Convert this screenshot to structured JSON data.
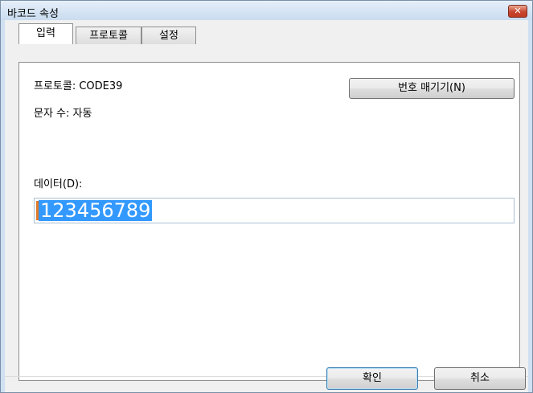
{
  "window": {
    "title": "바코드 속성",
    "close_symbol": "✕"
  },
  "tabs": [
    {
      "label": "입력",
      "active": true
    },
    {
      "label": "프로토콜",
      "active": false
    },
    {
      "label": "설정",
      "active": false
    }
  ],
  "input_tab": {
    "protocol_text": "프로토콜: CODE39",
    "char_count_text": "문자 수: 자동",
    "numbering_button": "번호 매기기(N)",
    "data_label": "데이터(D):",
    "data_value": "123456789"
  },
  "dialog_buttons": {
    "ok": "확인",
    "cancel": "취소"
  }
}
